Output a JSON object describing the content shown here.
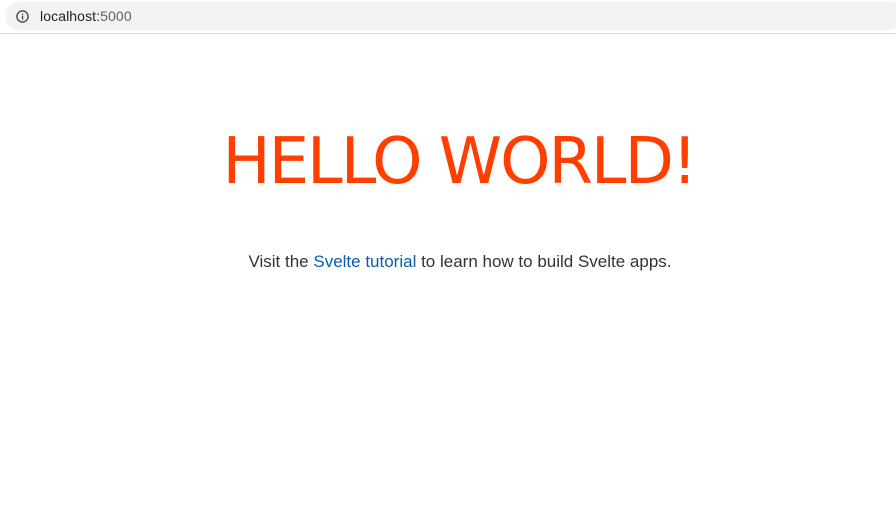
{
  "browser": {
    "url_host": "localhost:",
    "url_port": "5000"
  },
  "page": {
    "heading": "HELLO WORLD!",
    "intro_before": "Visit the ",
    "intro_link": "Svelte tutorial",
    "intro_after": " to learn how to build Svelte apps."
  },
  "colors": {
    "heading": "#ff3e00",
    "link": "#0b5cad",
    "text": "#333333",
    "omnibox": "#f1f3f4"
  },
  "icons": {
    "omnibox": "info-icon"
  }
}
